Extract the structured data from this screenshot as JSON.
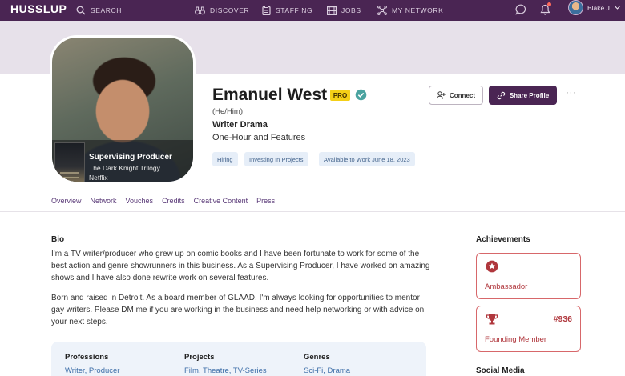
{
  "nav": {
    "logo": "HUSSLUP",
    "search_label": "SEARCH",
    "discover_label": "DISCOVER",
    "staffing_label": "STAFFING",
    "jobs_label": "JOBS",
    "network_label": "MY NETWORK",
    "user_name": "Blake J."
  },
  "photo_caption": {
    "role": "Supervising Producer",
    "title": "The Dark Knight Trilogy",
    "studio": "Netflix"
  },
  "profile": {
    "name": "Emanuel West",
    "badge": "PRO",
    "pronouns": "(He/Him)",
    "headline": "Writer Drama",
    "subline": "One-Hour and Features",
    "chips": [
      "Hiring",
      "Investing In Projects",
      "Available to Work June 18, 2023"
    ]
  },
  "actions": {
    "connect_label": "Connect",
    "share_label": "Share Profile",
    "more_label": "···"
  },
  "tabs": [
    "Overview",
    "Network",
    "Vouches",
    "Credits",
    "Creative Content",
    "Press"
  ],
  "bio": {
    "heading": "Bio",
    "paragraph_1": "I'm a TV writer/producer who grew up on comic books and I have been fortunate to work for some of the best action and genre showrunners in this business. As a Supervising Producer, I have worked on amazing shows and I have also done rewrite work on several features.",
    "paragraph_2": "Born and raised in Detroit. As a board member of GLAAD, I'm always looking for opportunities to mentor gay writers. Please DM me if you are working in the business and need help networking or with advice on your next steps."
  },
  "info": {
    "professions_label": "Professions",
    "professions_value": "Writer, Producer",
    "projects_label": "Projects",
    "projects_value": "Film, Theatre, TV-Series",
    "genres_label": "Genres",
    "genres_value": "Sci-Fi, Drama"
  },
  "achievements": {
    "heading": "Achievements",
    "items": [
      {
        "label": "Ambassador",
        "number": ""
      },
      {
        "label": "Founding Member",
        "number": "#936"
      }
    ]
  },
  "social": {
    "heading": "Social Media"
  },
  "colors": {
    "brand": "#4a2553",
    "pro_badge": "#f4cf17",
    "achievement": "#b0373d",
    "chip_bg": "#e6eef8",
    "link": "#3d6ea8"
  }
}
